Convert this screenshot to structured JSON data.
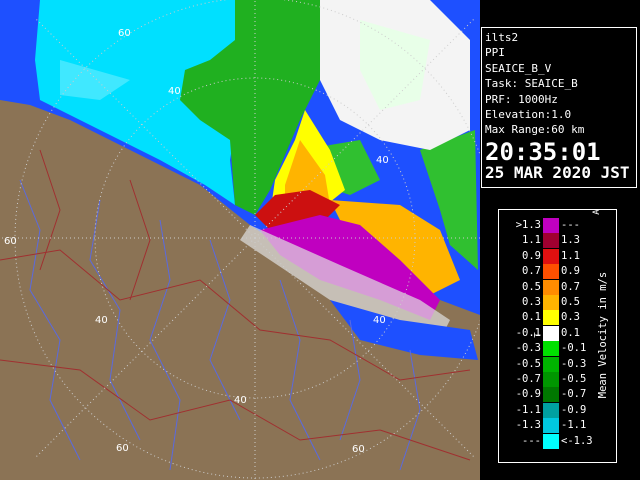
{
  "info": {
    "lines": [
      "ilts2",
      "PPI",
      "SEAICE_B_V",
      "Task: SEAICE_B",
      "PRF: 1000Hz",
      "Elevation:1.0",
      "Max Range:60 km"
    ],
    "time": "20:35:01",
    "date": "25 MAR 2020 JST"
  },
  "legend": {
    "unit_label": "Mean Velocity in m/s",
    "rows": [
      {
        "lo": ">1.3",
        "hi": "---",
        "color": "#c000c0"
      },
      {
        "lo": "1.1",
        "hi": "1.3",
        "color": "#a00030"
      },
      {
        "lo": "0.9",
        "hi": "1.1",
        "color": "#e01010"
      },
      {
        "lo": "0.7",
        "hi": "0.9",
        "color": "#ff5000"
      },
      {
        "lo": "0.5",
        "hi": "0.7",
        "color": "#ff8c00"
      },
      {
        "lo": "0.3",
        "hi": "0.5",
        "color": "#ffb400"
      },
      {
        "lo": "0.1",
        "hi": "0.3",
        "color": "#ffff00"
      },
      {
        "lo": "-0.1",
        "hi": "0.1",
        "color": "#ffffff"
      },
      {
        "lo": "-0.3",
        "hi": "-0.1",
        "color": "#00e000"
      },
      {
        "lo": "-0.5",
        "hi": "-0.3",
        "color": "#00b400"
      },
      {
        "lo": "-0.7",
        "hi": "-0.5",
        "color": "#009600"
      },
      {
        "lo": "-0.9",
        "hi": "-0.7",
        "color": "#007800"
      },
      {
        "lo": "-1.1",
        "hi": "-0.9",
        "color": "#00a0a0"
      },
      {
        "lo": "-1.3",
        "hi": "-1.1",
        "color": "#00c8e0"
      },
      {
        "lo": "---",
        "hi": "<-1.3",
        "color": "#00ffff"
      }
    ]
  },
  "map": {
    "range_labels": [
      "60",
      "40",
      "40",
      "40",
      "40",
      "60",
      "40",
      "60",
      "60"
    ],
    "colors": {
      "land": "#8b7355",
      "sea": "#1e50ff",
      "cyan": "#00e0ff"
    }
  }
}
